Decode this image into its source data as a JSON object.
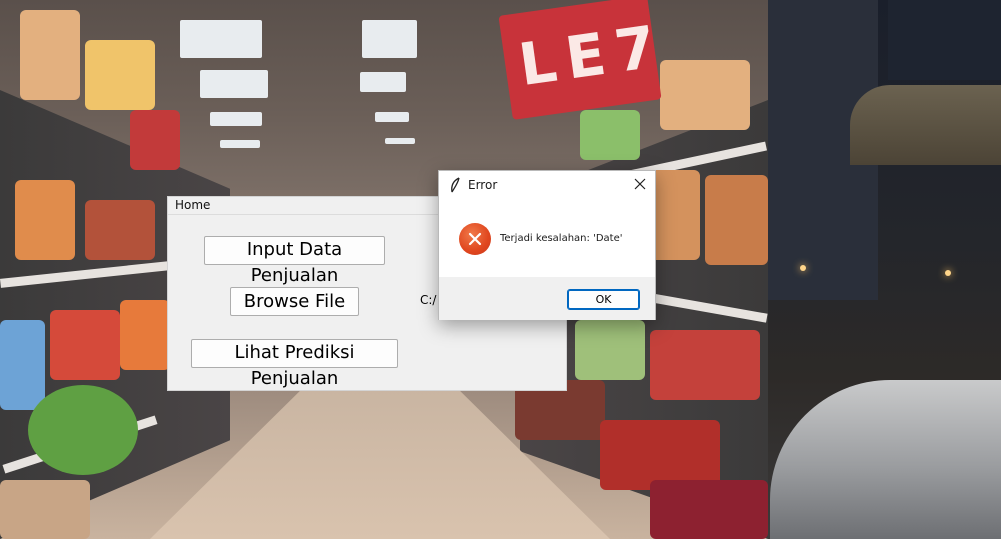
{
  "app_window": {
    "tab_label": "Home",
    "buttons": {
      "input_data": "Input Data Penjualan",
      "browse_file": "Browse File",
      "lihat_prediksi": "Lihat Prediksi Penjualan"
    },
    "file_path": "C:/"
  },
  "error_dialog": {
    "title": "Error",
    "message": "Terjadi kesalahan: 'Date'",
    "ok_label": "OK",
    "icon": "error-x-icon",
    "accent_color": "#0067c0",
    "error_color": "#e0461e"
  },
  "background": {
    "sign_text": "LE7"
  }
}
